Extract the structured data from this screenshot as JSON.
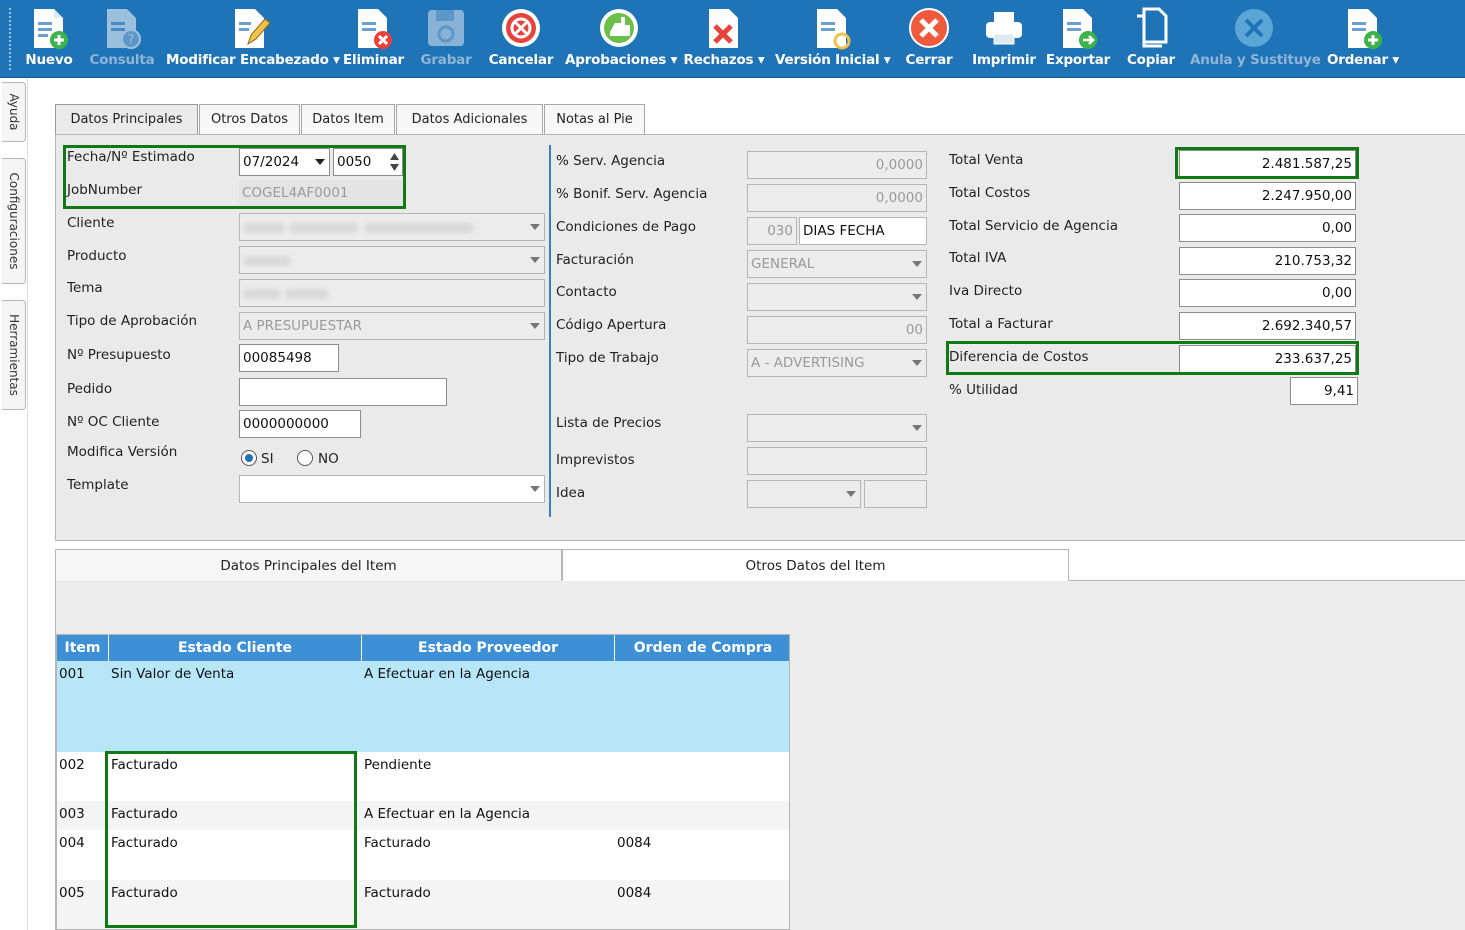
{
  "toolbar": {
    "buttons": [
      {
        "label": "Nuevo",
        "icon": "new-document-icon",
        "enabled": true
      },
      {
        "label": "Consulta",
        "icon": "query-document-icon",
        "enabled": false
      },
      {
        "label": "Modificar Encabezado",
        "icon": "edit-document-icon",
        "enabled": true,
        "dropdown": true
      },
      {
        "label": "Eliminar",
        "icon": "delete-document-icon",
        "enabled": true
      },
      {
        "label": "Grabar",
        "icon": "save-disk-icon",
        "enabled": false
      },
      {
        "label": "Cancelar",
        "icon": "cancel-circle-icon",
        "enabled": true
      },
      {
        "label": "Aprobaciones",
        "icon": "approve-circle-icon",
        "enabled": true,
        "dropdown": true
      },
      {
        "label": "Rechazos",
        "icon": "reject-document-icon",
        "enabled": true,
        "dropdown": true
      },
      {
        "label": "Versión Inicial",
        "icon": "initial-version-icon",
        "enabled": true,
        "dropdown": true
      },
      {
        "label": "Cerrar",
        "icon": "close-circle-icon",
        "enabled": true
      },
      {
        "label": "Imprimir",
        "icon": "printer-icon",
        "enabled": true
      },
      {
        "label": "Exportar",
        "icon": "export-document-icon",
        "enabled": true
      },
      {
        "label": "Copiar",
        "icon": "copy-icon",
        "enabled": true
      },
      {
        "label": "Anula y Sustituye",
        "icon": "void-circle-icon",
        "enabled": false
      },
      {
        "label": "Ordenar",
        "icon": "order-document-icon",
        "enabled": true,
        "dropdown": true
      }
    ],
    "dropdown_marker": "▾",
    "colors": {
      "bar": "#1f73b7",
      "disabled": "#8fb6d6"
    }
  },
  "side_tabs": [
    "Ayuda",
    "Configuraciones",
    "Herramientas"
  ],
  "main_tabs": [
    "Datos Principales",
    "Otros Datos",
    "Datos Item",
    "Datos Adicionales",
    "Notas al Pie"
  ],
  "form": {
    "left": {
      "fecha_label": "Fecha/Nº Estimado",
      "fecha_value": "07/2024",
      "estimado_value": "0050",
      "jobnumber_label": "JobNumber",
      "jobnumber_value": "COGEL4AF0001",
      "cliente_label": "Cliente",
      "producto_label": "Producto",
      "tema_label": "Tema",
      "tipo_aprobacion_label": "Tipo de Aprobación",
      "tipo_aprobacion_value": "A PRESUPUESTAR",
      "presupuesto_label": "Nº Presupuesto",
      "presupuesto_value": "00085498",
      "pedido_label": "Pedido",
      "pedido_value": "",
      "oc_label": "Nº OC Cliente",
      "oc_value": "0000000000",
      "modifica_label": "Modifica Versión",
      "si_label": "SI",
      "no_label": "NO",
      "template_label": "Template",
      "template_value": ""
    },
    "middle": {
      "serv_agencia_label": "% Serv. Agencia",
      "serv_agencia_value": "0,0000",
      "bonif_label": "% Bonif. Serv. Agencia",
      "bonif_value": "0,0000",
      "condiciones_label": "Condiciones de Pago",
      "condiciones_code": "030",
      "condiciones_value": "DIAS FECHA",
      "facturacion_label": "Facturación",
      "facturacion_value": "GENERAL",
      "contacto_label": "Contacto",
      "contacto_value": "",
      "codigo_label": "Código Apertura",
      "codigo_value": "00",
      "tipo_trabajo_label": "Tipo de Trabajo",
      "tipo_trabajo_value": "A - ADVERTISING",
      "lista_label": "Lista de Precios",
      "lista_value": "",
      "imprevistos_label": "Imprevistos",
      "imprevistos_value": "",
      "idea_label": "Idea",
      "idea_value": ""
    },
    "right": {
      "total_venta_label": "Total Venta",
      "total_venta_value": "2.481.587,25",
      "total_costos_label": "Total Costos",
      "total_costos_value": "2.247.950,00",
      "total_servicio_label": "Total Servicio de Agencia",
      "total_servicio_value": "0,00",
      "total_iva_label": "Total IVA",
      "total_iva_value": "210.753,32",
      "iva_directo_label": "Iva Directo",
      "iva_directo_value": "0,00",
      "total_facturar_label": "Total a Facturar",
      "total_facturar_value": "2.692.340,57",
      "diferencia_label": "Diferencia de Costos",
      "diferencia_value": "233.637,25",
      "utilidad_label": "% Utilidad",
      "utilidad_value": "9,41"
    }
  },
  "item_tabs": [
    "Datos Principales del Item",
    "Otros Datos del Item"
  ],
  "grid": {
    "columns": [
      "Item",
      "Estado Cliente",
      "Estado Proveedor",
      "Orden de Compra"
    ],
    "rows": [
      {
        "item": "001",
        "estado_cliente": "Sin Valor de Venta",
        "estado_proveedor": "A Efectuar en la Agencia",
        "orden": ""
      },
      {
        "item": "002",
        "estado_cliente": "Facturado",
        "estado_proveedor": "Pendiente",
        "orden": ""
      },
      {
        "item": "003",
        "estado_cliente": "Facturado",
        "estado_proveedor": "A Efectuar en la Agencia",
        "orden": ""
      },
      {
        "item": "004",
        "estado_cliente": "Facturado",
        "estado_proveedor": "Facturado",
        "orden": "0084"
      },
      {
        "item": "005",
        "estado_cliente": "Facturado",
        "estado_proveedor": "Facturado",
        "orden": "0084"
      }
    ],
    "colors": {
      "header": "#3d8fd6",
      "selected_row": "#b6e6f8",
      "highlight": "#0f7a15"
    }
  }
}
